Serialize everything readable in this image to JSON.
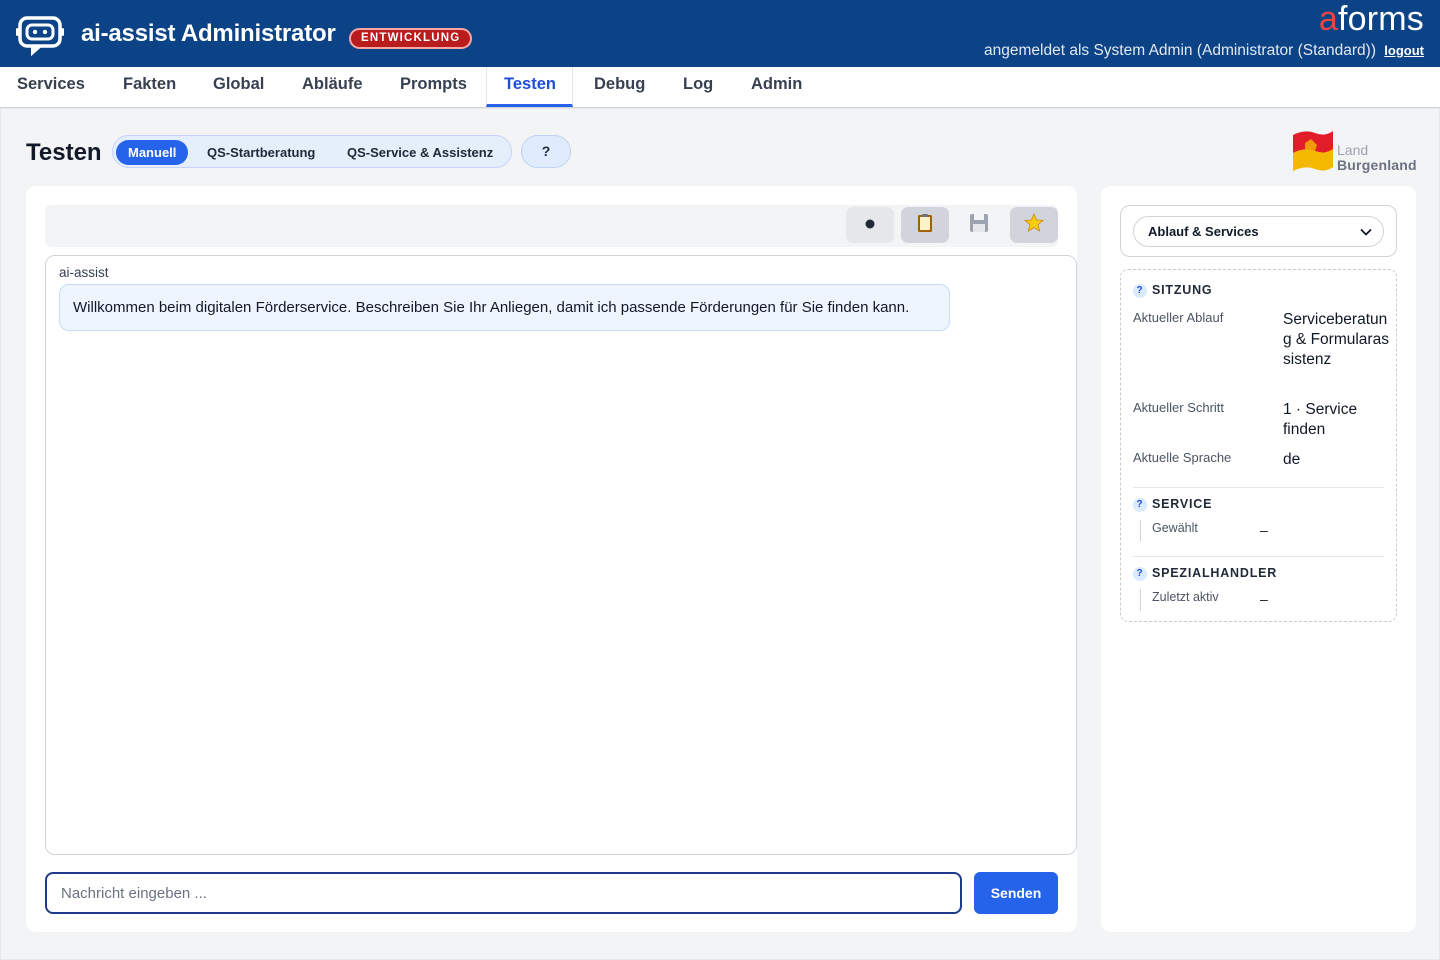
{
  "header": {
    "app_title": "ai-assist Administrator",
    "env_badge": "ENTWICKLUNG",
    "brand_a": "a",
    "brand_rest": "forms",
    "user_text": "angemeldet als System Admin (Administrator (Standard))",
    "logout_label": "logout"
  },
  "nav": {
    "tabs": [
      {
        "label": "Services"
      },
      {
        "label": "Fakten"
      },
      {
        "label": "Global"
      },
      {
        "label": "Abläufe"
      },
      {
        "label": "Prompts"
      },
      {
        "label": "Testen"
      },
      {
        "label": "Debug"
      },
      {
        "label": "Log"
      },
      {
        "label": "Admin"
      }
    ],
    "active": "Testen"
  },
  "page": {
    "title": "Testen",
    "modes": [
      {
        "label": "Manuell"
      },
      {
        "label": "QS-Startberatung"
      },
      {
        "label": "QS-Service & Assistenz"
      }
    ],
    "active_mode": "Manuell",
    "help_label": "?",
    "logo_line1": "Land",
    "logo_line2": "Burgenland"
  },
  "chat": {
    "toolbar_icons": [
      "record-icon",
      "clipboard-icon",
      "save-icon",
      "star-icon"
    ],
    "sender": "ai-assist",
    "message": "Willkommen beim digitalen Förderservice. Beschreiben Sie Ihr Anliegen, damit ich passende Förderungen für Sie finden kann.",
    "input_placeholder": "Nachricht eingeben ...",
    "send_label": "Senden"
  },
  "side": {
    "select_value": "Ablauf & Services",
    "sitzung": {
      "heading": "SITZUNG",
      "rows": [
        {
          "key": "Aktueller Ablauf",
          "value": "Serviceberatung & Formularassistenz"
        },
        {
          "key": "Aktueller Schritt",
          "value": "1 · Service finden"
        },
        {
          "key": "Aktuelle Sprache",
          "value": "de"
        }
      ]
    },
    "service": {
      "heading": "SERVICE",
      "key": "Gewählt",
      "value": "–"
    },
    "spezial": {
      "heading": "SPEZIALHANDLER",
      "key": "Zuletzt aktiv",
      "value": "–"
    }
  },
  "colors": {
    "header_bg": "#0b4386",
    "accent": "#2563eb",
    "env_badge": "#b91c1c",
    "brand_red": "#ef4444"
  }
}
